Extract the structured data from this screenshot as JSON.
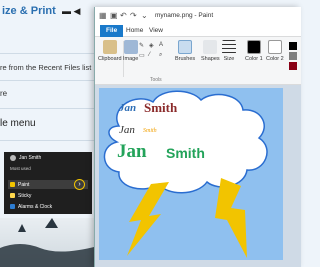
{
  "background_doc": {
    "title": "ize & Print",
    "line1": "re from the Recent Files list",
    "line2": "re",
    "line3": "le menu"
  },
  "start_menu": {
    "user": "Jan Smith",
    "most_used_label": "Most used",
    "items": [
      {
        "label": "Paint",
        "color": "#f2c400"
      },
      {
        "label": "Sticky",
        "color": "#ffd84d"
      },
      {
        "label": "Alarms & Clock",
        "color": "#2d7dd2"
      }
    ]
  },
  "paint": {
    "window_title": "myname.png - Paint",
    "tabs": [
      "File",
      "Home",
      "View"
    ],
    "ribbon": {
      "clipboard": "Clipboard",
      "image": "Image",
      "tools": "Tools",
      "brushes": "Brushes",
      "shapes": "Shapes",
      "size": "Size",
      "color1": "Color 1",
      "color2": "Color 2"
    },
    "canvas": {
      "bg_color": "#8fc0ef",
      "cloud_color": "#ffffff",
      "bolt_color": "#f2c400",
      "text1_a": "Jan",
      "text1_b": "Smith",
      "text2_a": "Jan",
      "text2_b": "Smith",
      "text3_a": "Jan",
      "text3_b": "Smith"
    }
  },
  "colors": {
    "accent": "#1979ca",
    "jan_blue": "#2d6db5",
    "smith_red": "#8b2b2b",
    "green": "#23a35a"
  }
}
